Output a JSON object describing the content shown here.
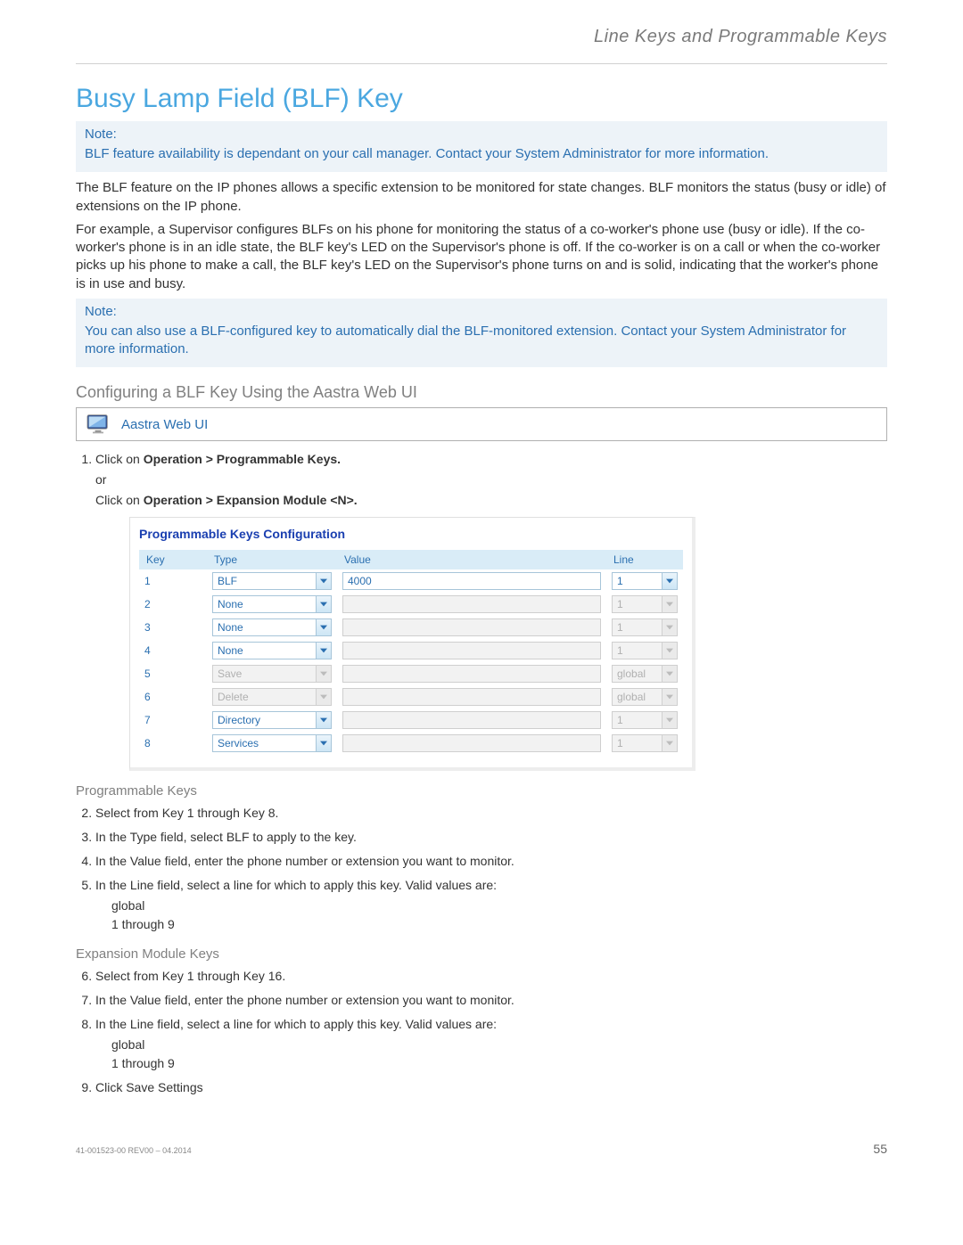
{
  "header": {
    "breadcrumb": "Line Keys and Programmable Keys"
  },
  "title": "Busy Lamp Field (BLF) Key",
  "note1": {
    "label": "Note:",
    "text": "BLF feature availability is dependant on your call manager. Contact your System Administrator for more information."
  },
  "para1": "The BLF feature on the IP phones allows a specific extension to be monitored for state changes. BLF monitors the status (busy or idle) of extensions on the IP phone.",
  "para2": "For example, a Supervisor configures BLFs on his phone for monitoring the status of a co-worker's phone use (busy or idle). If the co-worker's phone is in an idle state, the BLF key's LED on the Supervisor's phone is off. If the co-worker is on a call or when the co-worker picks up his phone to make a call, the BLF key's LED on the Supervisor's phone turns on and is solid, indicating that the worker's phone is in use and busy.",
  "note2": {
    "label": "Note:",
    "text": "You can also use a BLF-configured key to automatically dial the BLF-monitored extension. Contact your System Administrator for more information."
  },
  "subheading": "Configuring a BLF Key Using the Aastra Web UI",
  "webui_label": "Aastra Web UI",
  "step1": {
    "line1_pre": "Click on ",
    "line1_bold": "Operation > Programmable Keys.",
    "or": "or",
    "line2_pre": "Click on ",
    "line2_bold": "Operation > Expansion Module <N>."
  },
  "config": {
    "title": "Programmable Keys Configuration",
    "headers": {
      "key": "Key",
      "type": "Type",
      "value": "Value",
      "line": "Line"
    },
    "rows": [
      {
        "key": "1",
        "type": "BLF",
        "value": "4000",
        "line": "1",
        "type_enabled": true,
        "value_enabled": true,
        "line_enabled": true
      },
      {
        "key": "2",
        "type": "None",
        "value": "",
        "line": "1",
        "type_enabled": true,
        "value_enabled": false,
        "line_enabled": false
      },
      {
        "key": "3",
        "type": "None",
        "value": "",
        "line": "1",
        "type_enabled": true,
        "value_enabled": false,
        "line_enabled": false
      },
      {
        "key": "4",
        "type": "None",
        "value": "",
        "line": "1",
        "type_enabled": true,
        "value_enabled": false,
        "line_enabled": false
      },
      {
        "key": "5",
        "type": "Save",
        "value": "",
        "line": "global",
        "type_enabled": false,
        "value_enabled": false,
        "line_enabled": false
      },
      {
        "key": "6",
        "type": "Delete",
        "value": "",
        "line": "global",
        "type_enabled": false,
        "value_enabled": false,
        "line_enabled": false
      },
      {
        "key": "7",
        "type": "Directory",
        "value": "",
        "line": "1",
        "type_enabled": true,
        "value_enabled": false,
        "line_enabled": false
      },
      {
        "key": "8",
        "type": "Services",
        "value": "",
        "line": "1",
        "type_enabled": true,
        "value_enabled": false,
        "line_enabled": false
      }
    ]
  },
  "progkeys_heading": "Programmable Keys",
  "steps_prog": [
    "Select from Key 1 through Key 8.",
    "In the Type field, select BLF to apply to the key.",
    "In the Value field, enter the phone number or extension you want to monitor.",
    "In the Line field, select a line for which to apply this key. Valid values are:"
  ],
  "line_valid_values": [
    "global",
    "1 through 9"
  ],
  "expkeys_heading": "Expansion Module Keys",
  "steps_exp": [
    "Select from Key 1 through Key 16.",
    "In the Value field, enter the phone number or extension you want to monitor.",
    "In the Line field, select a line for which to apply this key. Valid values are:"
  ],
  "step9": "Click Save Settings",
  "footer": {
    "left": "41-001523-00 REV00 – 04.2014",
    "right": "55"
  }
}
